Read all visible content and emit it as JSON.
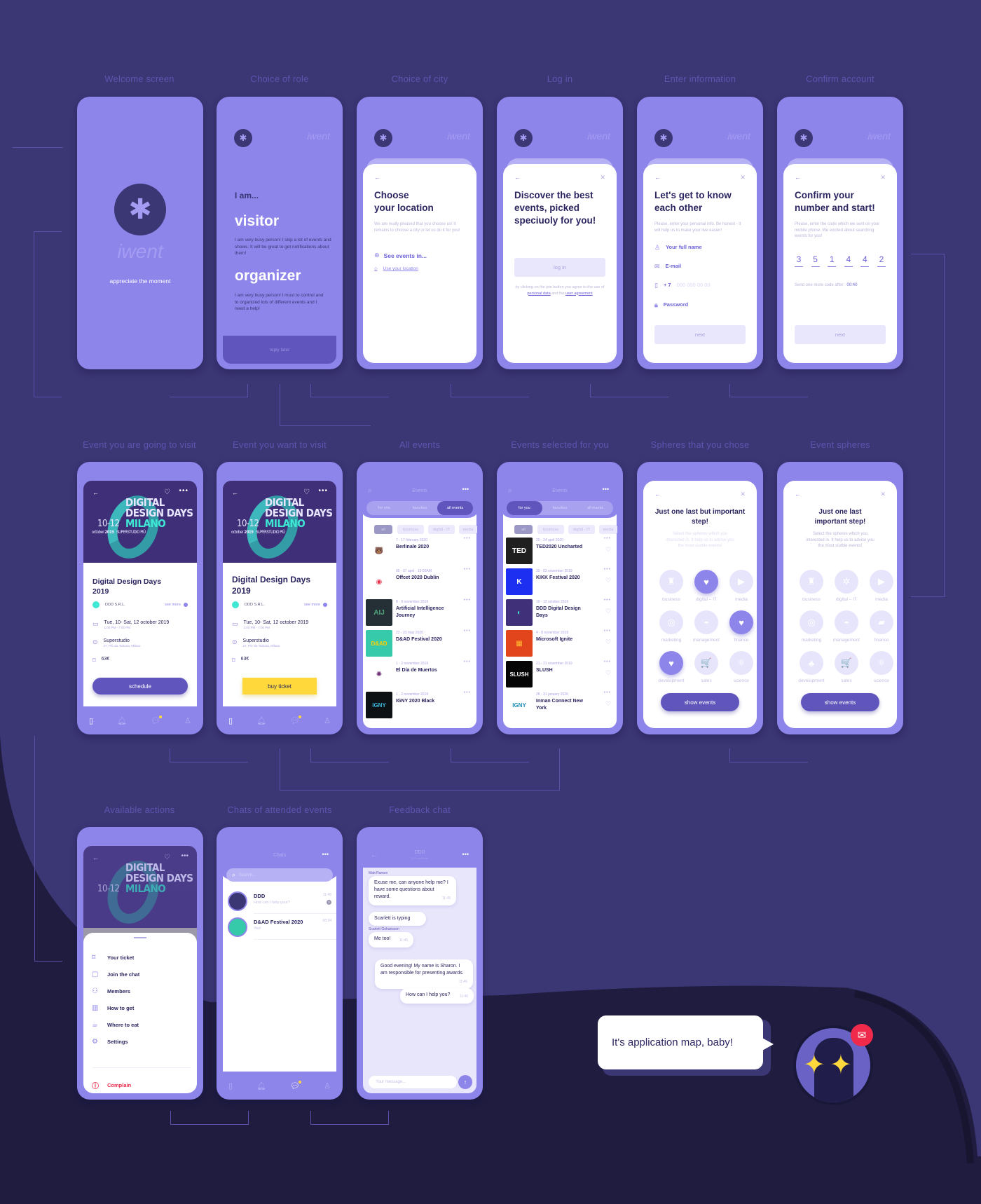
{
  "connector_color": "#5a52a8",
  "colors": {
    "background": "#3b3674",
    "background_dark": "#1f1c40",
    "phone": "#8e85ea",
    "primary": "#5f55bd",
    "accent_yellow": "#ffd93b",
    "accent_teal": "#3ee8d4",
    "danger": "#ef2a4b",
    "text_dark": "#2a2560"
  },
  "screen_labels": {
    "welcome": "Welcome screen",
    "role": "Choice of role",
    "city": "Choice of city",
    "login": "Log in",
    "info": "Enter information",
    "confirm": "Confirm account",
    "going": "Event you are going to visit",
    "want": "Event you want to visit",
    "all_events": "All events",
    "selected": "Events selected for you",
    "spheres_chose": "Spheres that you chose",
    "spheres": "Event spheres",
    "actions": "Available actions",
    "chats": "Chats of attended events",
    "feedback": "Feedback chat"
  },
  "brand": {
    "name": "iwent",
    "tagline": "appreciate the moment",
    "logo_icon": "jumping-person-icon"
  },
  "role": {
    "heading": "I am...",
    "visitor_title": "visitor",
    "visitor_text": "I am very busy person! I skip a lot of events and shows. It will be great to get notifications about them!",
    "organizer_title": "organizer",
    "organizer_text": "I am very busy person! I must to control and to organized lots of different events and I need a help!",
    "reply_later": "reply later"
  },
  "city": {
    "title_line1": "Choose",
    "title_line2": "your location",
    "text": "We are really pleased that you choose us! It remains to choose a city or let us do it for you!",
    "see_events": "See events in...",
    "use_location": "Use your location"
  },
  "login": {
    "title": "Discover the best events, picked speciuoly for you!",
    "button": "log in",
    "terms_pre": "by clicking on the join button you agree to the use of",
    "terms_link1": "personal data",
    "terms_mid": "and the",
    "terms_link2": "user agreement"
  },
  "info": {
    "title": "Let's get to know each other",
    "text": "Please, enter your personal info. Be honest - it will help us to make your live easier!",
    "name_label": "Your full name",
    "email_label": "E-mail",
    "phone_prefix": "+ 7",
    "phone_placeholder": "000 000 00 00",
    "password_label": "Password",
    "next": "next"
  },
  "confirm": {
    "title": "Confirm your number and start!",
    "text": "Please, enter the code which we sent on your mobile phone. We excited about searching events for you!",
    "code": [
      "3",
      "5",
      "1",
      "4",
      "4",
      "2"
    ],
    "resend_label": "Send one more code after:",
    "resend_timer": "00:40",
    "next": "next"
  },
  "event": {
    "poster_line1": "DIGITAL",
    "poster_line2": "DESIGN DAYS",
    "poster_dates": "10-12",
    "poster_city": "MILANO",
    "poster_month": "october",
    "poster_year": "2019",
    "poster_venue": "SUPERSTUDIO PIÙ",
    "title": "Digital Design Days 2019",
    "organizer": "DDD S.R.L.",
    "see_more": "see more",
    "date": "Tue, 10- Sat, 12 october 2019",
    "time": "1:00 PM - 7:00 PM",
    "venue": "Superstudio",
    "address": "27, Più via Tortona, Milano",
    "price": "63€",
    "schedule_button": "schedule",
    "buy_button": "buy ticket"
  },
  "events_screen": {
    "title": "Events",
    "tabs": [
      "for you",
      "favorites",
      "all events"
    ],
    "filters": [
      "all",
      "business",
      "digital - IT",
      "media"
    ]
  },
  "all_events": [
    {
      "date": "7 - 17 february 2020",
      "title": "Berlinale 2020",
      "thumb_bg": "#ffffff",
      "thumb_fg": "#e3262c",
      "thumb_text": "🐻"
    },
    {
      "date": "05 - 07 april - 10:00AM",
      "title": "Offcet 2020 Dublin",
      "thumb_bg": "#ffffff",
      "thumb_fg": "#e8344e",
      "thumb_text": "◉"
    },
    {
      "date": "8 - 9 november 2019",
      "title": "Artificial Intelligence Journey",
      "thumb_bg": "#243036",
      "thumb_fg": "#4fa57a",
      "thumb_text": "AIJ"
    },
    {
      "date": "22 - 23 may 2020",
      "title": "D&AD Festival 2020",
      "thumb_bg": "#36c9aa",
      "thumb_fg": "#ffd000",
      "thumb_text": "D&AD"
    },
    {
      "date": "1 - 2 november 2019",
      "title": "El Día de Muertos",
      "thumb_bg": "#ffffff",
      "thumb_fg": "#6b2a72",
      "thumb_text": "✺"
    },
    {
      "date": "1 - 2 november 2019",
      "title": "IGNY 2020 Black",
      "thumb_bg": "#0d1114",
      "thumb_fg": "#3ab7d8",
      "thumb_text": "IGNY"
    }
  ],
  "selected_events": [
    {
      "date": "20 - 24 april 2020",
      "title": "TED2020 Uncharted",
      "thumb_bg": "#1f1f1f",
      "thumb_fg": "#ffffff",
      "thumb_text": "TED"
    },
    {
      "date": "30 - 03 november 2019",
      "title": "KIKK Festival 2020",
      "thumb_bg": "#1d2ff0",
      "thumb_fg": "#ffffff",
      "thumb_text": "K"
    },
    {
      "date": "10 - 12 october 2019",
      "title": "DDD Digital Design Days",
      "thumb_bg": "#40307a",
      "thumb_fg": "#3ee8d4",
      "thumb_text": "◐"
    },
    {
      "date": "4 - 8 november 2019",
      "title": "Microsoft Ignite",
      "thumb_bg": "#e2451c",
      "thumb_fg": "#ffc02e",
      "thumb_text": "▦"
    },
    {
      "date": "21 - 21 november 2019",
      "title": "SLUSH",
      "thumb_bg": "#050505",
      "thumb_fg": "#ffffff",
      "thumb_text": "SLUSH"
    },
    {
      "date": "28 - 31 january 2020",
      "title": "Inman Connect New York",
      "thumb_bg": "#ffffff",
      "thumb_fg": "#1a8fb8",
      "thumb_text": "IGNY"
    }
  ],
  "spheres_screen": {
    "title_chose": "Just one last but important step!",
    "title": "Just one last important step!",
    "text": "Select the spheres which you interested in. It help us to advise you the most siutble events!",
    "button": "show events",
    "items": [
      {
        "label": "business",
        "icon": "♜",
        "chosen": false
      },
      {
        "label": "digital – IT",
        "icon": "✲",
        "chosen": true
      },
      {
        "label": "media",
        "icon": "▶",
        "chosen": false
      },
      {
        "label": "marketing",
        "icon": "◎",
        "chosen": false
      },
      {
        "label": "management",
        "icon": "◓",
        "chosen": false
      },
      {
        "label": "finance",
        "icon": "▰",
        "chosen": true
      },
      {
        "label": "development",
        "icon": "♣",
        "chosen": true
      },
      {
        "label": "sales",
        "icon": "🛒",
        "chosen": false
      },
      {
        "label": "science",
        "icon": "⚛",
        "chosen": false
      }
    ]
  },
  "actions_menu": [
    {
      "label": "Your ticket",
      "icon": "bookmark-icon",
      "glyph": "⌑"
    },
    {
      "label": "Join the chat",
      "icon": "chat-icon",
      "glyph": "▢"
    },
    {
      "label": "Members",
      "icon": "members-icon",
      "glyph": "⚇"
    },
    {
      "label": "How to get",
      "icon": "map-icon",
      "glyph": "▥"
    },
    {
      "label": "Where to eat",
      "icon": "cup-icon",
      "glyph": "☕"
    },
    {
      "label": "Settings",
      "icon": "gear-icon",
      "glyph": "⚙"
    }
  ],
  "complain": "Complain",
  "chats": {
    "title": "Chats",
    "search_placeholder": "Search...",
    "items": [
      {
        "name": "DDD",
        "preview": "How can I help your?",
        "time": "11:46",
        "unread": "2"
      },
      {
        "name": "D&AD Festival 2020",
        "preview": "Yes!",
        "time": "08:34",
        "unread": ""
      }
    ]
  },
  "feedback": {
    "title": "DDD",
    "subtitle": "203 members",
    "messages": [
      {
        "sender": "Matt Ramon",
        "text": "Exuse me, can anyone help me? I have some questions about reward.",
        "time": "11:45"
      },
      {
        "sender": "",
        "text": "Scarlett is typing",
        "time": ""
      },
      {
        "sender": "Scarlett Gohansson",
        "text": "Me too!",
        "time": "11:45"
      },
      {
        "sender": "",
        "text": "Good evening! My name is Sharon. I am responsible for presenting awards.",
        "time": "11:46"
      },
      {
        "sender": "",
        "text": "How can I help you?",
        "time": "11:46"
      }
    ],
    "input_placeholder": "Your message..."
  },
  "mascot": {
    "speech": "It's application map, baby!",
    "badge_icon": "mail-icon"
  }
}
